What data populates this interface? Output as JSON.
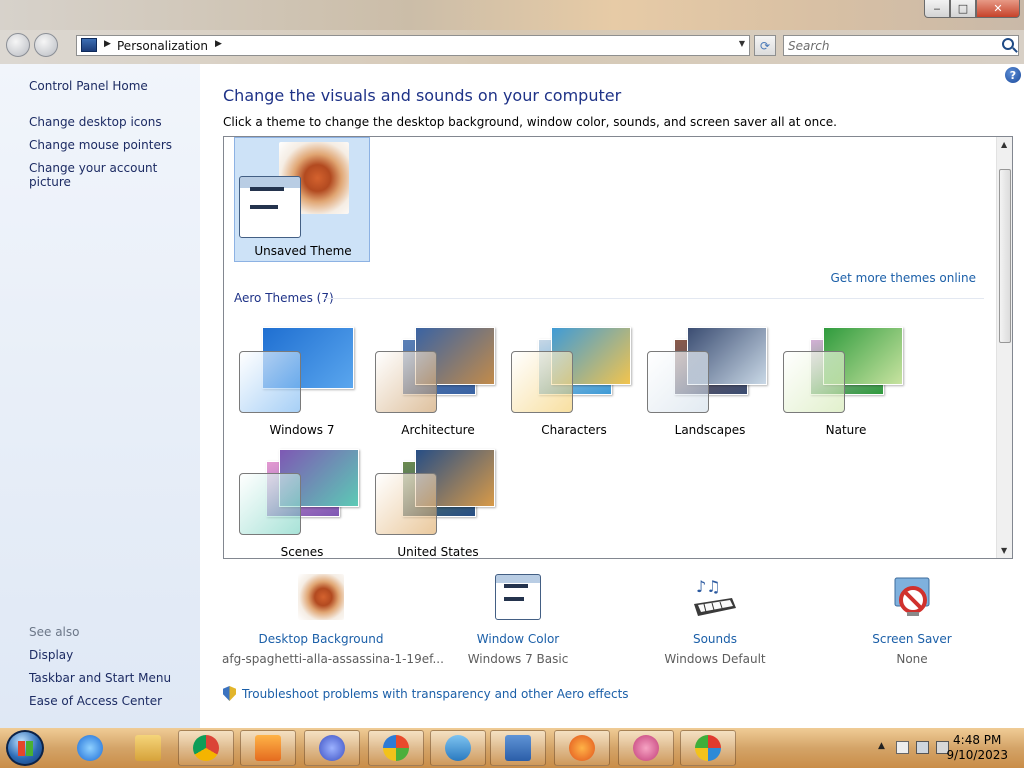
{
  "window": {
    "buttons": {
      "minimize": "‒",
      "maximize": "□",
      "close": "✕"
    }
  },
  "address_bar": {
    "breadcrumb": "Personalization",
    "search_placeholder": "Search"
  },
  "sidebar": {
    "top_links": [
      "Control Panel Home",
      "Change desktop icons",
      "Change mouse pointers",
      "Change your account picture"
    ],
    "see_also_heading": "See also",
    "see_also_links": [
      "Display",
      "Taskbar and Start Menu",
      "Ease of Access Center"
    ]
  },
  "main": {
    "title": "Change the visuals and sounds on your computer",
    "description": "Click a theme to change the desktop background, window color, sounds, and screen saver all at once.",
    "my_theme": {
      "name": "Unsaved Theme"
    },
    "get_more_link": "Get more themes online",
    "aero_section_label": "Aero Themes (7)",
    "aero_themes": [
      {
        "name": "Windows 7",
        "colors": [
          "#1f6fd1",
          "#5aa6ee",
          "#0b3d8c"
        ]
      },
      {
        "name": "Architecture",
        "colors": [
          "#3a63a3",
          "#c28b4a",
          "#5a7fb5"
        ]
      },
      {
        "name": "Characters",
        "colors": [
          "#3f9bd6",
          "#f2c44e",
          "#c6d7e6"
        ]
      },
      {
        "name": "Landscapes",
        "colors": [
          "#3b4d72",
          "#c9d8e6",
          "#8a5a4a"
        ]
      },
      {
        "name": "Nature",
        "colors": [
          "#2f9b3d",
          "#c8e3a0",
          "#d3b0d6"
        ]
      },
      {
        "name": "Scenes",
        "colors": [
          "#7e58b4",
          "#5ccab5",
          "#e39ad1"
        ]
      },
      {
        "name": "United States",
        "colors": [
          "#274e85",
          "#d89a48",
          "#6c8b4e"
        ]
      }
    ]
  },
  "bottom_items": [
    {
      "label": "Desktop Background",
      "value": "afg-spaghetti-alla-assassina-1-19ef..."
    },
    {
      "label": "Window Color",
      "value": "Windows 7 Basic"
    },
    {
      "label": "Sounds",
      "value": "Windows Default"
    },
    {
      "label": "Screen Saver",
      "value": "None"
    }
  ],
  "troubleshoot_link": "Troubleshoot problems with transparency and other Aero effects",
  "taskbar": {
    "apps": [
      "internet-explorer",
      "windows-explorer",
      "chrome",
      "media-player",
      "infinity-app",
      "windows-live",
      "paper-plane-app",
      "control-panel",
      "firefox",
      "snipping-tool",
      "paint"
    ],
    "time": "4:48 PM",
    "date": "9/10/2023"
  }
}
